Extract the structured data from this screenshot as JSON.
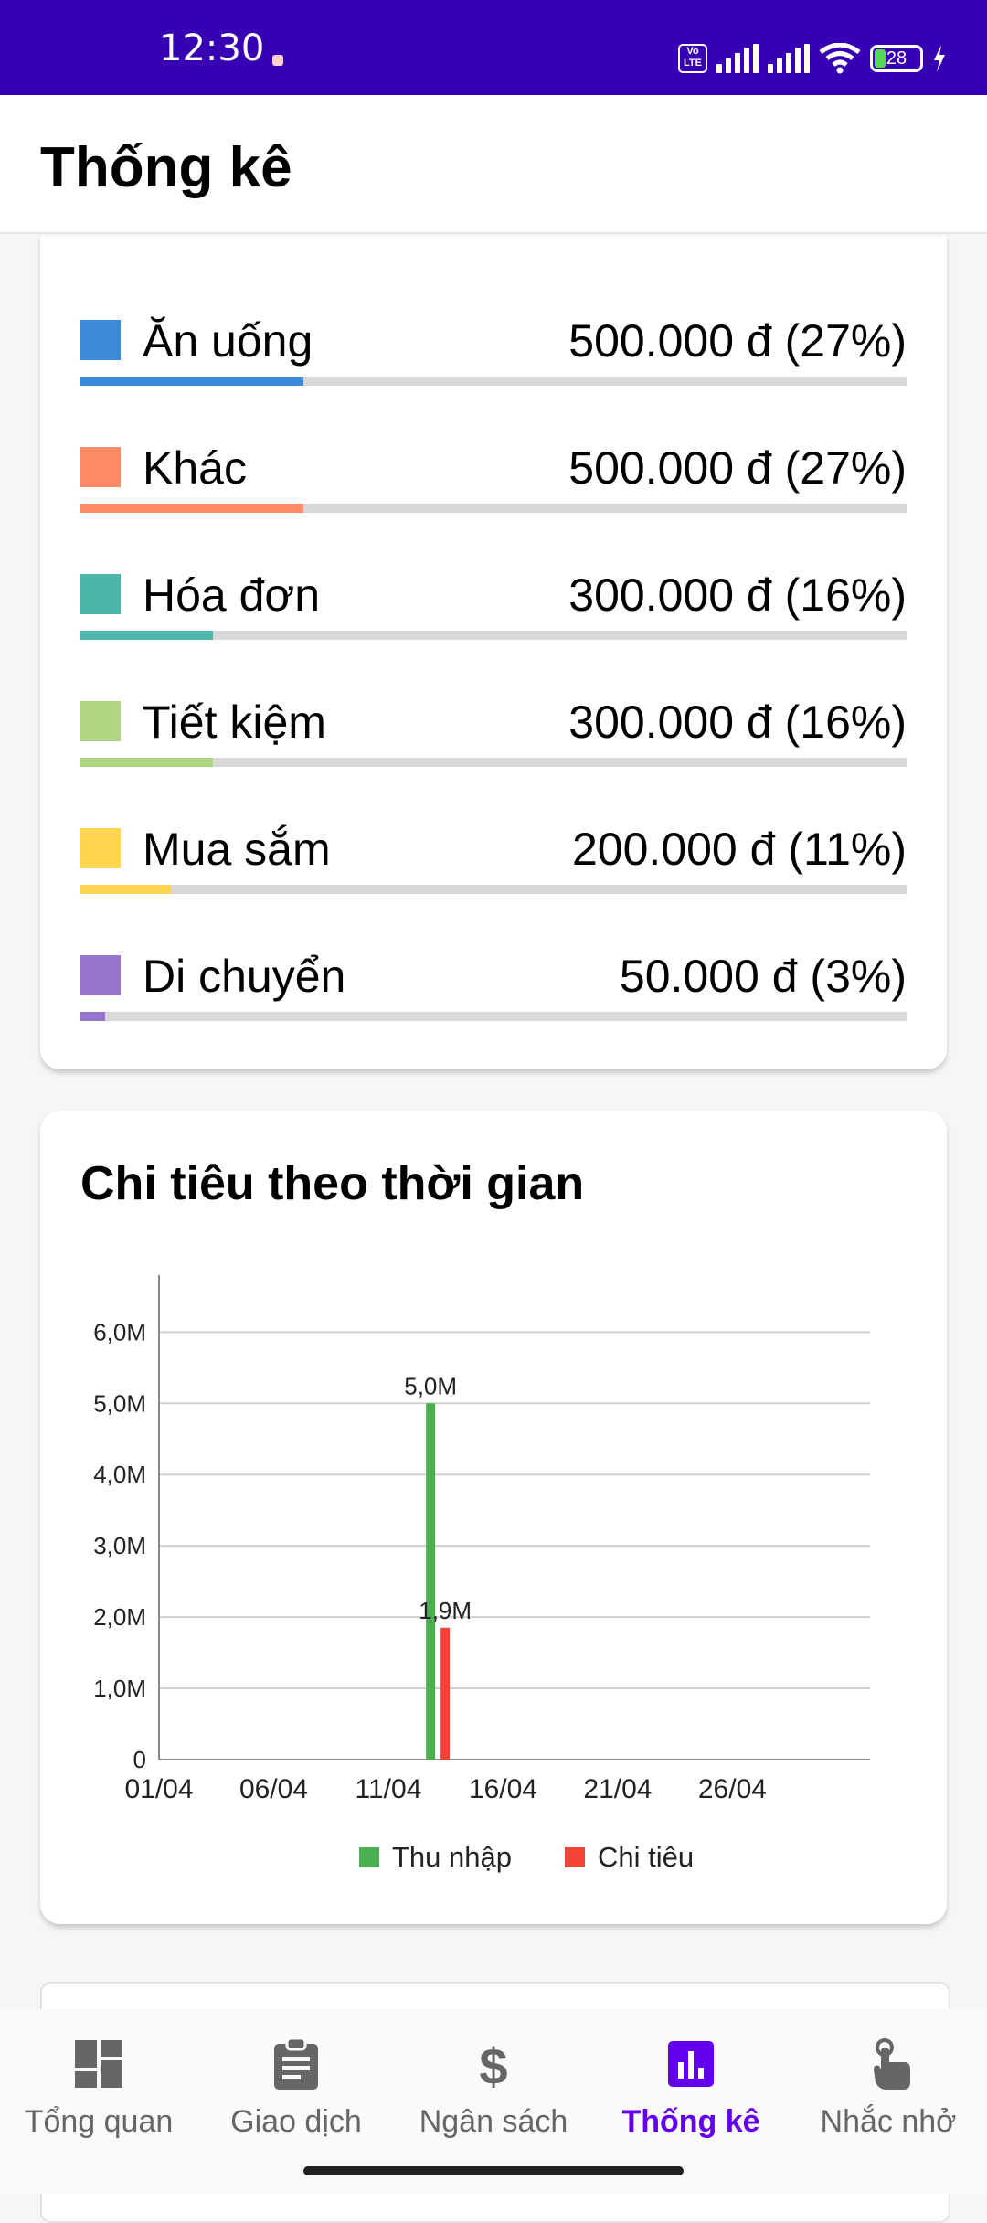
{
  "status": {
    "time": "12:30",
    "battery": "28",
    "volte": "Vo LTE"
  },
  "appbar": {
    "title": "Thống kê"
  },
  "categories": [
    {
      "name": "Ăn uống",
      "amount": "500.000 đ (27%)",
      "percent": 27,
      "color": "#3b89d9"
    },
    {
      "name": "Khác",
      "amount": "500.000 đ (27%)",
      "percent": 27,
      "color": "#ff8a65"
    },
    {
      "name": "Hóa đơn",
      "amount": "300.000 đ (16%)",
      "percent": 16,
      "color": "#4db6ac"
    },
    {
      "name": "Tiết kiệm",
      "amount": "300.000 đ (16%)",
      "percent": 16,
      "color": "#aed581"
    },
    {
      "name": "Mua sắm",
      "amount": "200.000 đ (11%)",
      "percent": 11,
      "color": "#ffd54f"
    },
    {
      "name": "Di chuyển",
      "amount": "50.000 đ (3%)",
      "percent": 3,
      "color": "#9575cd"
    }
  ],
  "time_card": {
    "title": "Chi tiêu theo thời gian"
  },
  "chart_data": {
    "type": "bar",
    "x_start": "01/04",
    "x_ticks": [
      "01/04",
      "06/04",
      "11/04",
      "16/04",
      "21/04",
      "26/04"
    ],
    "y_ticks": [
      "0",
      "1,0M",
      "2,0M",
      "3,0M",
      "4,0M",
      "5,0M",
      "6,0M"
    ],
    "ylim": [
      0,
      6.8
    ],
    "xlim": [
      "01/04",
      "02/05"
    ],
    "grid": true,
    "legend_position": "bottom-center",
    "series": [
      {
        "name": "Thu nhập",
        "color": "#4caf50",
        "points": [
          {
            "x": "13/04",
            "value": 5.0,
            "label": "5,0M"
          }
        ]
      },
      {
        "name": "Chi tiêu",
        "color": "#f44336",
        "points": [
          {
            "x": "13/04",
            "value": 1.85,
            "label": "1,9M"
          }
        ]
      }
    ]
  },
  "nav": {
    "items": [
      {
        "label": "Tổng quan",
        "icon": "dashboard-icon"
      },
      {
        "label": "Giao dịch",
        "icon": "clipboard-icon"
      },
      {
        "label": "Ngân sách",
        "icon": "dollar-icon"
      },
      {
        "label": "Thống kê",
        "icon": "bar-chart-icon",
        "active": true
      },
      {
        "label": "Nhắc nhở",
        "icon": "touch-icon"
      }
    ],
    "active_color": "#6200ee",
    "inactive_color": "#666666"
  }
}
